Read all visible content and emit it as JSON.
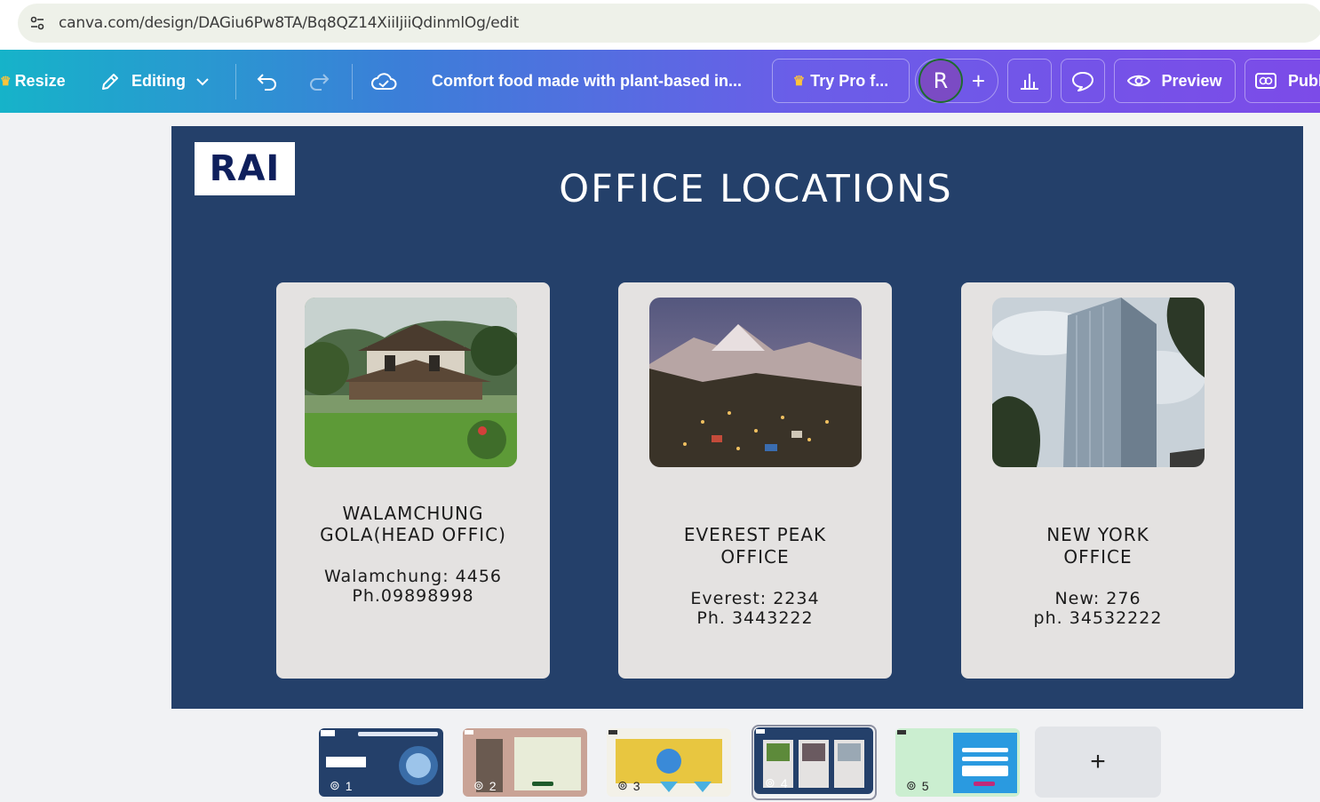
{
  "browser": {
    "url": "canva.com/design/DAGiu6Pw8TA/Bq8QZ14XiiIjiiQdinmlOg/edit"
  },
  "toolbar": {
    "resize_label": "Resize",
    "editing_label": "Editing",
    "doc_title": "Comfort food made with plant-based in...",
    "try_pro_label": "Try Pro f...",
    "avatar_letter": "R",
    "preview_label": "Preview",
    "publish_label": "Publ"
  },
  "slide": {
    "logo_text": "RAI",
    "title": "OFFICE LOCATIONS",
    "background": "#24406a",
    "cards": [
      {
        "name_line1": "WALAMCHUNG",
        "name_line2": "GOLA(HEAD OFFIC)",
        "addr_line1": "Walamchung: 4456",
        "addr_line2": "Ph.09898998",
        "photo": "house-in-garden-photo"
      },
      {
        "name_line1": "EVEREST PEAK",
        "name_line2": "OFFICE",
        "addr_line1": "Everest: 2234",
        "addr_line2": "Ph. 3443222",
        "photo": "mountain-town-photo"
      },
      {
        "name_line1": "NEW YORK",
        "name_line2": "OFFICE",
        "addr_line1": "New: 276",
        "addr_line2": "ph. 34532222",
        "photo": "glass-skyscraper-photo"
      }
    ]
  },
  "filmstrip": {
    "pages": [
      {
        "number": "1",
        "label": "page-1"
      },
      {
        "number": "2",
        "label": "page-2"
      },
      {
        "number": "3",
        "label": "page-3"
      },
      {
        "number": "4",
        "label": "page-4",
        "selected": true
      },
      {
        "number": "5",
        "label": "page-5"
      }
    ],
    "add_label": "+"
  }
}
